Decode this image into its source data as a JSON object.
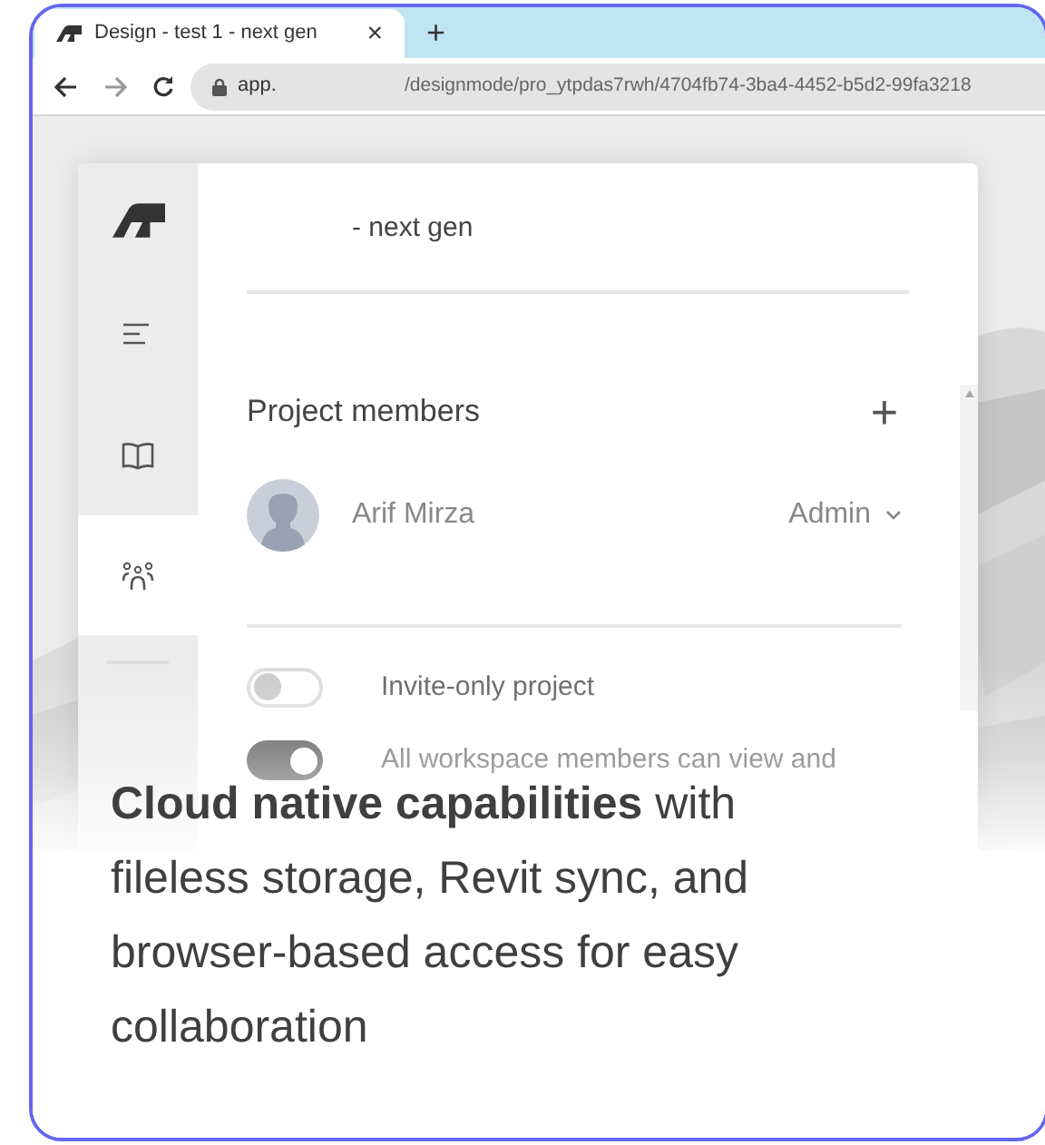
{
  "browser": {
    "tab": {
      "title": "Design - test 1 - next gen",
      "close": "×"
    },
    "new_tab": "+",
    "url": {
      "host": "app.",
      "path": "/designmode/pro_ytpdas7rwh/4704fb74-3ba4-4452-b5d2-99fa3218"
    }
  },
  "sidebar": {
    "items": [
      {
        "kind": "outline",
        "selected": false
      },
      {
        "kind": "library",
        "selected": false
      },
      {
        "kind": "members",
        "selected": true
      }
    ]
  },
  "panel": {
    "title": "- next gen",
    "section_title": "Project members",
    "add": "+",
    "members": [
      {
        "name": "Arif Mirza",
        "role": "Admin"
      }
    ],
    "settings": [
      {
        "label": "Invite-only project",
        "on": false
      },
      {
        "label": "All workspace members can view and",
        "on": true
      }
    ]
  },
  "caption": "**Cloud native capabilities** with fileless storage, Revit sync, and browser-based access for easy collaboration"
}
